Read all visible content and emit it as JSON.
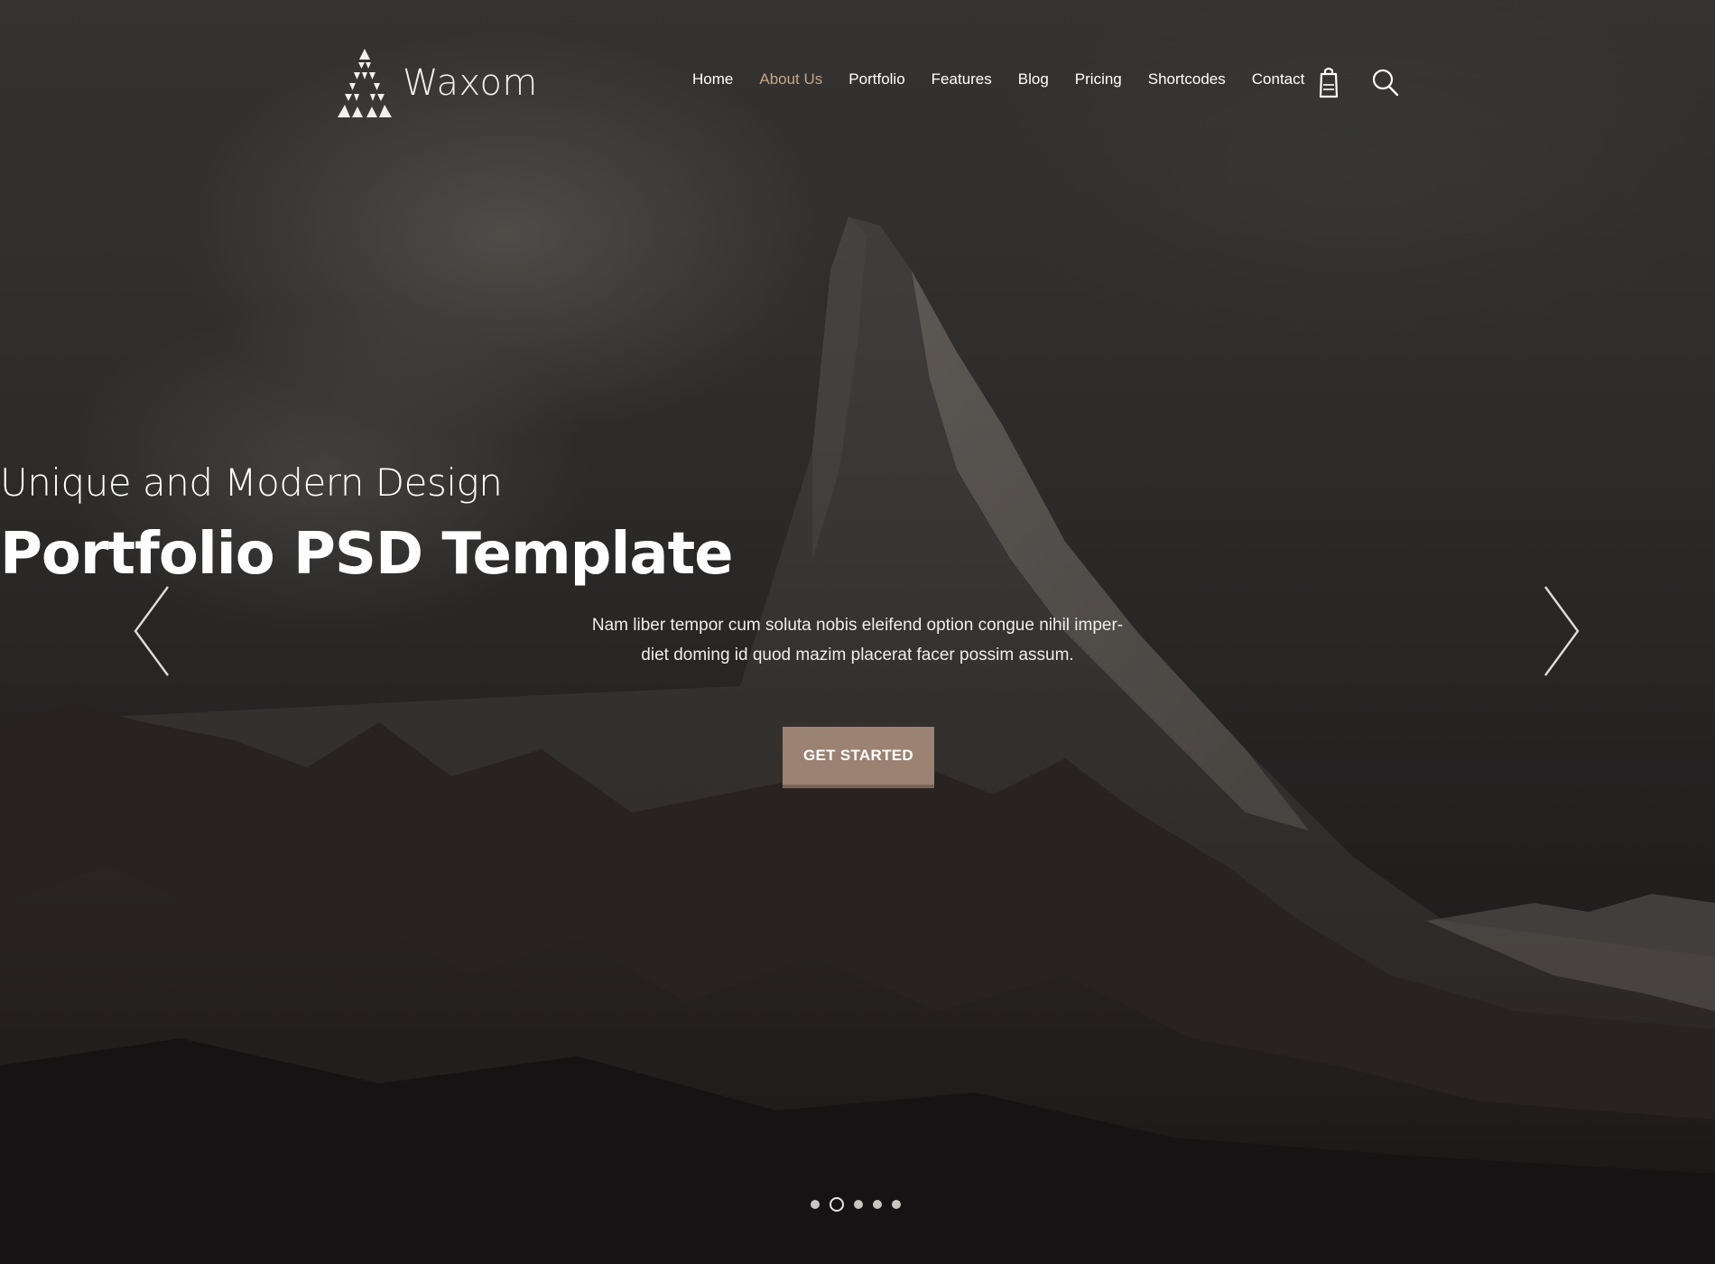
{
  "brand": {
    "name": "Waxom",
    "logo_icon": "triangle-mosaic-logo-icon"
  },
  "nav": {
    "items": [
      {
        "label": "Home",
        "active": false
      },
      {
        "label": "About Us",
        "active": true
      },
      {
        "label": "Portfolio",
        "active": false
      },
      {
        "label": "Features",
        "active": false
      },
      {
        "label": "Blog",
        "active": false
      },
      {
        "label": "Pricing",
        "active": false
      },
      {
        "label": "Shortcodes",
        "active": false
      },
      {
        "label": "Contact",
        "active": false
      }
    ],
    "active_color": "#c5a68a"
  },
  "header_icons": {
    "cart": "shopping-bag-icon",
    "search": "search-icon"
  },
  "hero": {
    "subtitle": "Unique and Modern Design",
    "title": "Portfolio PSD Template",
    "description": "Nam liber tempor cum soluta nobis eleifend option congue nihil imper-diet doming id quod mazim placerat facer possim assum.",
    "cta_label": "GET STARTED",
    "cta_color": "#9b8272",
    "prev_icon": "chevron-left-icon",
    "next_icon": "chevron-right-icon"
  },
  "slider": {
    "slide_count": 5,
    "active_index": 1
  }
}
